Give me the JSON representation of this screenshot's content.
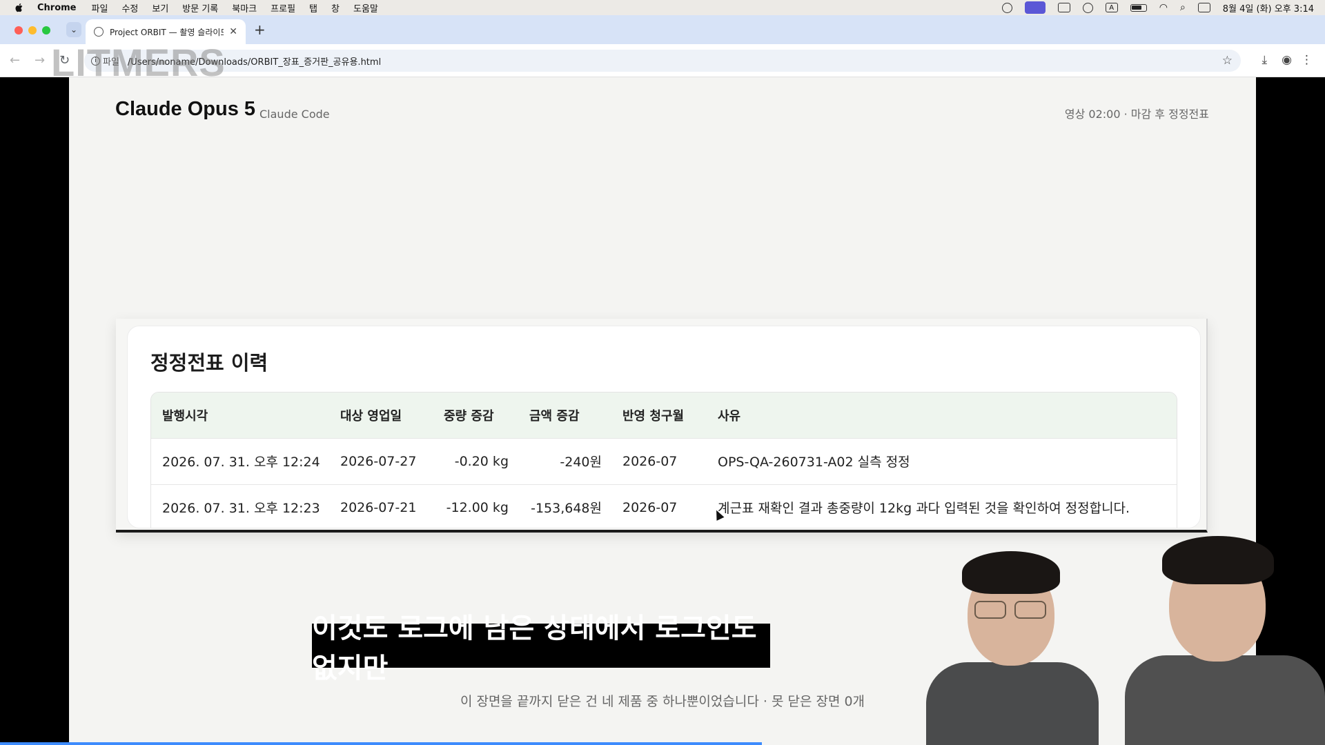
{
  "menubar": {
    "app_name": "Chrome",
    "menus": [
      "파일",
      "수정",
      "보기",
      "방문 기록",
      "북마크",
      "프로필",
      "탭",
      "창",
      "도움말"
    ],
    "clock": "8월 4일 (화) 오후 3:14",
    "input_indicator": "A"
  },
  "browser": {
    "tab_title": "Project ORBIT — 촬영 슬라이드",
    "url_scheme_label": "파일",
    "url": "/Users/noname/Downloads/ORBIT_장표_증거판_공유용.html"
  },
  "watermark": "LITMERS",
  "page": {
    "brand_title": "Claude Opus 5",
    "brand_sub": "Claude Code",
    "top_note": "영상 02:00 · 마감 후 정정전표",
    "card_title": "정정전표 이력",
    "table": {
      "headers": [
        "발행시각",
        "대상 영업일",
        "중량 증감",
        "금액 증감",
        "반영 청구월",
        "사유"
      ],
      "rows": [
        [
          "2026. 07. 31. 오후 12:24",
          "2026-07-27",
          "-0.20 kg",
          "-240원",
          "2026-07",
          "OPS-QA-260731-A02 실측 정정"
        ],
        [
          "2026. 07. 31. 오후 12:23",
          "2026-07-21",
          "-12.00 kg",
          "-153,648원",
          "2026-07",
          "계근표 재확인 결과 총중량이 12kg 과다 입력된 것을 확인하여 정정합니다."
        ]
      ]
    },
    "footer_note": "이 장면을 끝까지 닫은 건 네 제품 중 하나뿐이었습니다 · 못 닫은 장면 0개"
  },
  "subtitle": "이것도 로그에 남은 상태에서 로그인도 없지만",
  "video_progress": 0.575
}
